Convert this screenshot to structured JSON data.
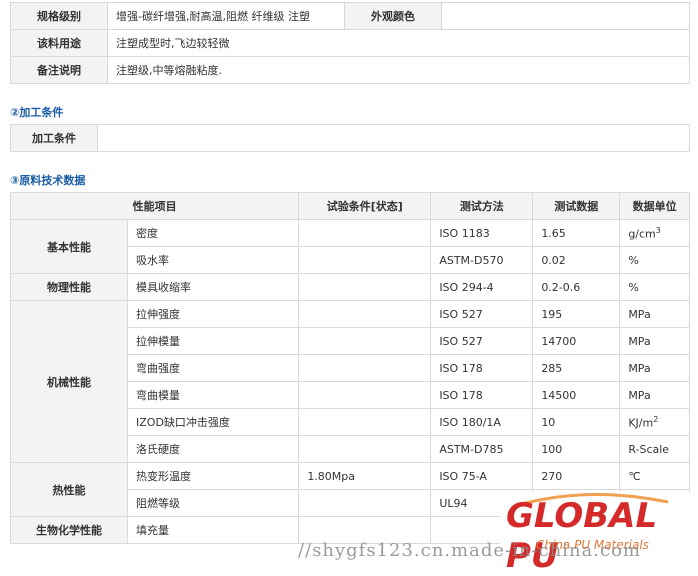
{
  "info": {
    "rows": [
      {
        "label": "规格级别",
        "value": "增强-碳纤增强,耐高温,阻燃 纤维级 注塑",
        "label2": "外观颜色",
        "value2": ""
      },
      {
        "label": "该料用途",
        "value": "注塑成型时,飞边较轻微"
      },
      {
        "label": "备注说明",
        "value": "注塑级,中等熔融粘度."
      }
    ]
  },
  "processing": {
    "section_num": "②",
    "section_title": "加工条件",
    "label": "加工条件",
    "value": ""
  },
  "technical": {
    "section_num": "③",
    "section_title": "原料技术数据",
    "headers": [
      "性能项目",
      "试验条件[状态]",
      "测试方法",
      "测试数据",
      "数据单位"
    ],
    "groups": {
      "basic": "基本性能",
      "physical": "物理性能",
      "mechanical": "机械性能",
      "thermal": "热性能",
      "biochem": "生物化学性能"
    },
    "rows": [
      {
        "item": "密度",
        "cond": "",
        "method": "ISO 1183",
        "value": "1.65",
        "unit": "g/cm",
        "unit_sup": "3"
      },
      {
        "item": "吸水率",
        "cond": "",
        "method": "ASTM-D570",
        "value": "0.02",
        "unit": "%"
      },
      {
        "item": "模具收缩率",
        "cond": "",
        "method": "ISO 294-4",
        "value": "0.2-0.6",
        "unit": "%"
      },
      {
        "item": "拉伸强度",
        "cond": "",
        "method": "ISO 527",
        "value": "195",
        "unit": "MPa"
      },
      {
        "item": "拉伸模量",
        "cond": "",
        "method": "ISO 527",
        "value": "14700",
        "unit": "MPa"
      },
      {
        "item": "弯曲强度",
        "cond": "",
        "method": "ISO 178",
        "value": "285",
        "unit": "MPa"
      },
      {
        "item": "弯曲模量",
        "cond": "",
        "method": "ISO 178",
        "value": "14500",
        "unit": "MPa"
      },
      {
        "item": "IZOD缺口冲击强度",
        "cond": "",
        "method": "ISO 180/1A",
        "value": "10",
        "unit": "KJ/m",
        "unit_sup": "2"
      },
      {
        "item": "洛氏硬度",
        "cond": "",
        "method": "ASTM-D785",
        "value": "100",
        "unit": "R-Scale"
      },
      {
        "item": "热变形温度",
        "cond": "1.80Mpa",
        "method": "ISO 75-A",
        "value": "270",
        "unit": "℃"
      },
      {
        "item": "阻燃等级",
        "cond": "",
        "method": "UL94",
        "value": "",
        "unit": ""
      },
      {
        "item": "填充量",
        "cond": "",
        "method": "",
        "value": "",
        "unit": ""
      }
    ]
  },
  "logo": {
    "word_main": "GLOBAL",
    "word_pu": "PU",
    "tagline": "China PU Materials"
  },
  "watermark": "//shygfs123.cn.made-in-china.com"
}
